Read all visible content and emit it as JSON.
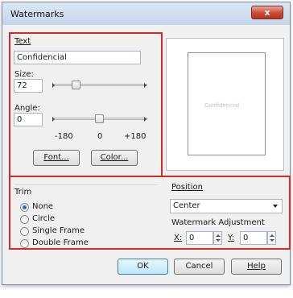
{
  "window": {
    "title": "Watermarks",
    "close_glyph": "x"
  },
  "text_section": {
    "label": "Text",
    "value": "Confidencial"
  },
  "size": {
    "label": "Size:",
    "value": "72",
    "level": 0.2
  },
  "angle": {
    "label": "Angle:",
    "value": "0",
    "level": 0.5,
    "scale": [
      "-180",
      "0",
      "+180"
    ]
  },
  "buttons": {
    "font": "Font...",
    "color": "Color...",
    "ok": "OK",
    "cancel": "Cancel",
    "help": "Help"
  },
  "preview": {
    "text": "Confidencial"
  },
  "trim": {
    "label": "Trim",
    "selected": "None",
    "options": [
      "None",
      "Circle",
      "Single Frame",
      "Double Frame"
    ]
  },
  "position": {
    "label": "Position",
    "selected": "Center"
  },
  "adjustment": {
    "label": "Watermark Adjustment",
    "x_label": "X:",
    "x_value": "0",
    "y_label": "Y:",
    "y_value": "0"
  },
  "colors": {
    "highlight": "#d42a2a",
    "accent": "#2a6bc4"
  }
}
